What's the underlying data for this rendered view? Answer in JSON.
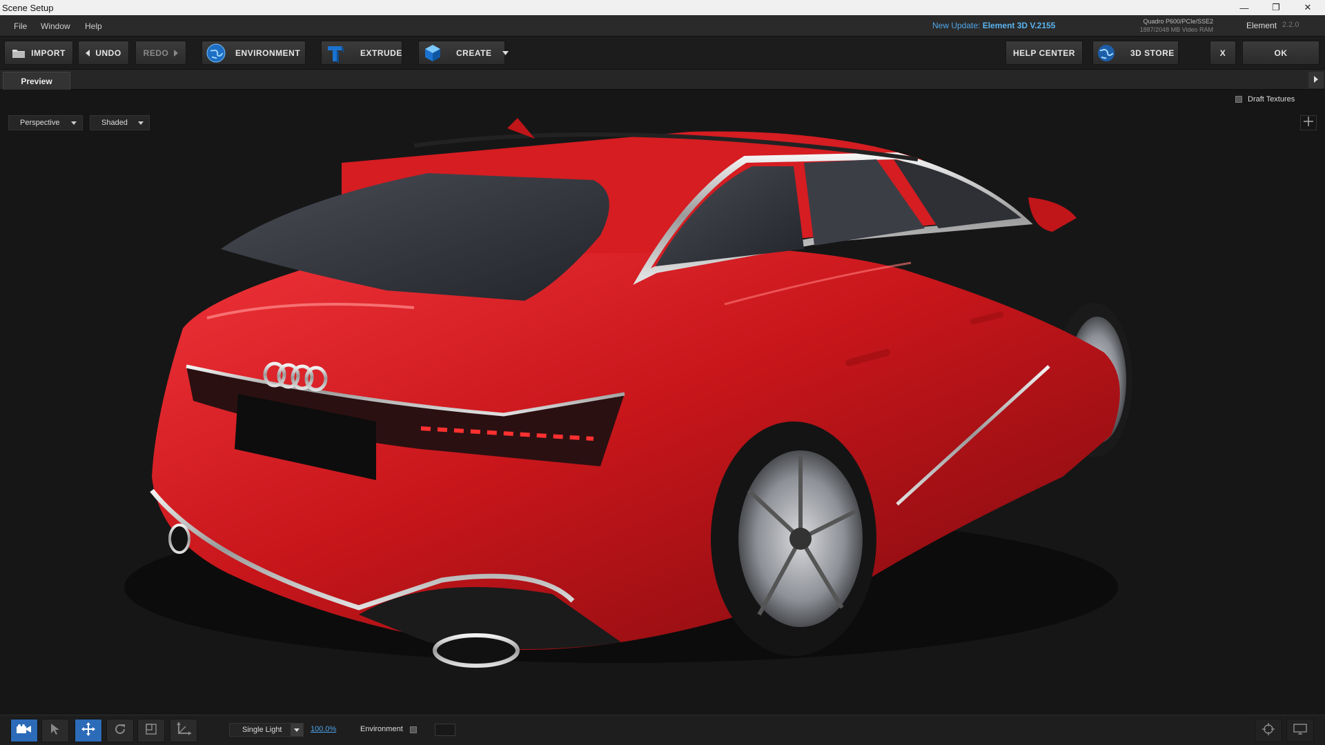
{
  "window": {
    "title": "Scene Setup",
    "controls": {
      "minimize": "—",
      "restore": "❐",
      "close": "✕"
    }
  },
  "menu": {
    "items": [
      "File",
      "Window",
      "Help"
    ],
    "update_prefix": "New Update:",
    "update_version": "Element 3D V.2155",
    "gpu": "Quadro P600/PCIe/SSE2",
    "vram": "1887/2048 MB Video RAM",
    "app_name": "Element",
    "app_version": "2.2.0"
  },
  "toolbar": {
    "import": "IMPORT",
    "undo": "UNDO",
    "redo": "REDO",
    "environment": "ENVIRONMENT",
    "extrude": "EXTRUDE",
    "create": "CREATE",
    "help_center": "HELP CENTER",
    "store": "3D STORE",
    "close": "X",
    "ok": "OK"
  },
  "tabs": {
    "active": "Preview"
  },
  "viewport": {
    "draft_textures_label": "Draft Textures",
    "draft_textures_checked": false,
    "camera_view": "Perspective",
    "shading_mode": "Shaded"
  },
  "bottombar": {
    "tools": [
      "camera-icon",
      "select-icon",
      "move-icon",
      "rotate-icon",
      "scale-icon",
      "axis-icon"
    ],
    "active_tool": "move-icon",
    "lighting": "Single Light",
    "light_intensity": "100.0%",
    "environment_label": "Environment",
    "environment_checked": false
  },
  "colors": {
    "accent_blue": "#2c6bb8",
    "link_blue": "#4da3e8",
    "car_paint": "#c8161b"
  }
}
